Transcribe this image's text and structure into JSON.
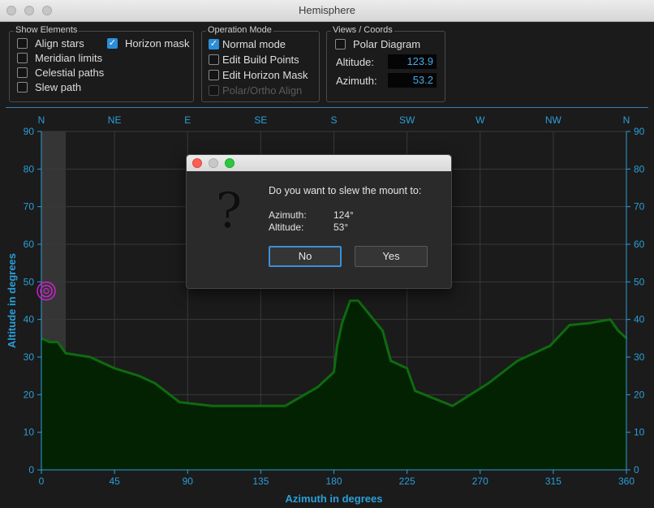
{
  "window": {
    "title": "Hemisphere"
  },
  "show_elements": {
    "legend": "Show Elements",
    "items": [
      {
        "label": "Align stars",
        "checked": false
      },
      {
        "label": "Horizon mask",
        "checked": true
      },
      {
        "label": "Meridian limits",
        "checked": false
      },
      {
        "label": "Celestial paths",
        "checked": false
      },
      {
        "label": "Slew path",
        "checked": false
      }
    ]
  },
  "operation_mode": {
    "legend": "Operation Mode",
    "items": [
      {
        "label": "Normal mode",
        "checked": true
      },
      {
        "label": "Edit Build Points",
        "checked": false
      },
      {
        "label": "Edit Horizon Mask",
        "checked": false
      },
      {
        "label": "Polar/Ortho Align",
        "checked": false,
        "disabled": true
      }
    ]
  },
  "views": {
    "legend": "Views / Coords",
    "polar_label": "Polar Diagram",
    "polar_checked": false,
    "altitude_label": "Altitude:",
    "altitude_value": "123.9",
    "azimuth_label": "Azimuth:",
    "azimuth_value": "53.2"
  },
  "chart_data": {
    "type": "area",
    "xlabel": "Azimuth in degrees",
    "ylabel": "Altitude in degrees",
    "xlim": [
      0,
      360
    ],
    "ylim": [
      0,
      90
    ],
    "x_ticks": [
      0,
      45,
      90,
      135,
      180,
      225,
      270,
      315,
      360
    ],
    "y_ticks": [
      0,
      10,
      20,
      30,
      40,
      50,
      60,
      70,
      80,
      90
    ],
    "compass": [
      {
        "az": 0,
        "label": "N"
      },
      {
        "az": 45,
        "label": "NE"
      },
      {
        "az": 90,
        "label": "E"
      },
      {
        "az": 135,
        "label": "SE"
      },
      {
        "az": 180,
        "label": "S"
      },
      {
        "az": 225,
        "label": "SW"
      },
      {
        "az": 270,
        "label": "W"
      },
      {
        "az": 315,
        "label": "NW"
      },
      {
        "az": 360,
        "label": "N"
      }
    ],
    "grid": true,
    "horizon_mask": {
      "az": [
        0,
        5,
        10,
        15,
        30,
        45,
        60,
        70,
        85,
        105,
        135,
        150,
        170,
        180,
        182,
        185,
        190,
        195,
        210,
        215,
        225,
        230,
        253,
        275,
        293,
        313,
        325,
        337,
        350,
        355,
        360
      ],
      "alt": [
        35,
        34,
        34,
        31,
        30,
        27,
        25,
        23,
        18,
        17,
        17,
        17,
        22,
        26,
        33,
        39,
        45,
        45,
        37,
        29,
        27,
        21,
        17,
        23,
        29,
        33,
        38.5,
        39,
        40,
        37,
        35
      ]
    },
    "meridian_band_az": [
      0,
      15
    ],
    "mount_position": {
      "az": 2,
      "alt": 48
    },
    "colors": {
      "axis": "#2a9fd8",
      "mask_line": "#0e6b0e",
      "mask_fill": "#022202",
      "mount": "#d020d0",
      "grid": "#3a3a3a"
    }
  },
  "dialog": {
    "question": "Do you want to slew the mount to:",
    "azimuth_label": "Azimuth:",
    "azimuth_value": "124°",
    "altitude_label": "Altitude:",
    "altitude_value": "53°",
    "no_label": "No",
    "yes_label": "Yes"
  }
}
